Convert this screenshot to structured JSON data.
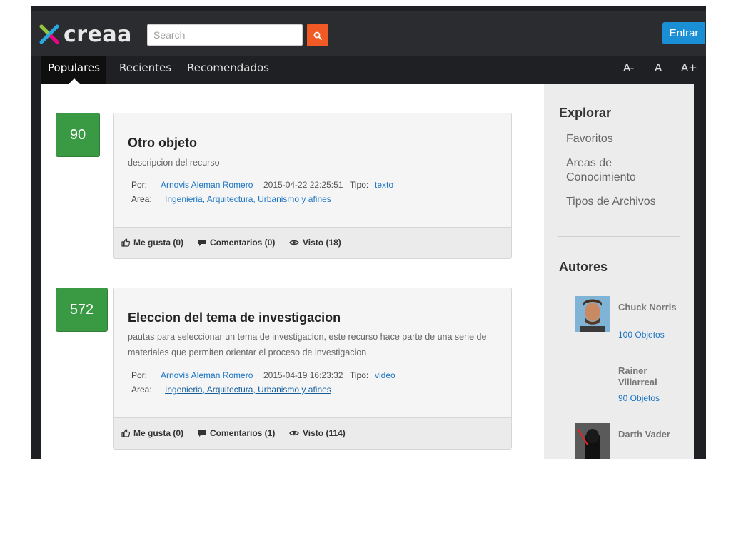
{
  "header": {
    "logo_text": "creaa",
    "search_placeholder": "Search",
    "login_label": "Entrar"
  },
  "nav": {
    "tabs": [
      "Populares",
      "Recientes",
      "Recomendados"
    ],
    "active_tab": "Populares",
    "font_controls": [
      "A-",
      "A",
      "A+"
    ]
  },
  "resources": [
    {
      "score": "90",
      "title": "Otro objeto",
      "description": "descripcion del recurso",
      "por_label": "Por:",
      "author": "Arnovis Aleman Romero",
      "date": "2015-04-22 22:25:51",
      "tipo_label": "Tipo:",
      "tipo": "texto",
      "area_label": "Area:",
      "area": "Ingenieria, Arquitectura, Urbanismo y afines",
      "likes": "Me gusta (0)",
      "comments": "Comentarios (0)",
      "views": "Visto (18)"
    },
    {
      "score": "572",
      "title": "Eleccion del tema de investigacion",
      "description": "pautas para seleccionar un tema de investigacion, este recurso hace parte de una serie de materiales que permiten orientar el proceso de investigacion",
      "por_label": "Por:",
      "author": "Arnovis Aleman Romero",
      "date": "2015-04-19 16:23:32",
      "tipo_label": "Tipo:",
      "tipo": "video",
      "area_label": "Area:",
      "area": "Ingenieria, Arquitectura, Urbanismo y afines",
      "likes": "Me gusta (0)",
      "comments": "Comentarios (1)",
      "views": "Visto (114)"
    }
  ],
  "sidebar": {
    "explore_title": "Explorar",
    "explore_links": [
      "Favoritos",
      "Areas de Conocimiento",
      "Tipos de Archivos"
    ],
    "authors_title": "Autores",
    "authors": [
      {
        "name": "Chuck Norris",
        "count": "100 Objetos"
      },
      {
        "name": "Rainer Villarreal",
        "count": "90 Objetos"
      },
      {
        "name": "Darth Vader",
        "count": ""
      }
    ]
  },
  "colors": {
    "accent_orange": "#f15a24",
    "accent_blue": "#1a8fd6",
    "score_green": "#3a9a44",
    "link_blue": "#1a74c4"
  }
}
